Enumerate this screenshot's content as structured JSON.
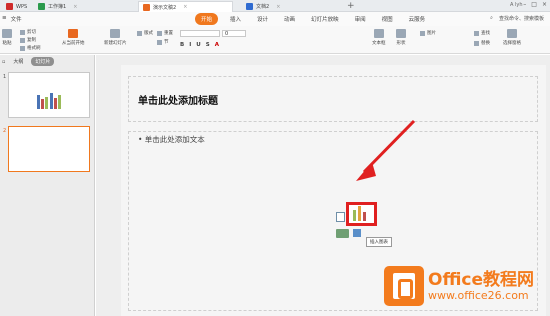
{
  "titlebar": {
    "tabs": [
      {
        "label": "WPS",
        "color": "#cf2b2b"
      },
      {
        "label": "工作簿1",
        "color": "#2a9a4c"
      },
      {
        "label": "演示文稿2",
        "color": "#e86820"
      },
      {
        "label": "文档2",
        "color": "#2f6bd1"
      }
    ],
    "account": "A lyh"
  },
  "menu": {
    "file": "文件",
    "tabs": [
      "开始",
      "插入",
      "设计",
      "动画",
      "幻灯片放映",
      "审阅",
      "视图",
      "云服务"
    ],
    "active_tab": "开始",
    "search": "查找命令、搜索模板"
  },
  "ribbon": {
    "paste": "粘贴",
    "cut": "剪切",
    "copy": "复制",
    "format": "格式刷",
    "play_from": "从当前开始",
    "new_slide": "新建幻灯片",
    "layout": "版式",
    "reset": "重置",
    "section": "节",
    "font_size": "0",
    "textbox": "文本框",
    "shape": "形状",
    "picture": "图片",
    "find": "查找",
    "replace": "替换",
    "select_pane": "选择窗格",
    "format_buttons": [
      "B",
      "I",
      "U",
      "S",
      "A"
    ]
  },
  "panel": {
    "tabs": [
      "大纲",
      "幻灯片"
    ],
    "active_tab": "幻灯片",
    "slide_numbers": [
      "1",
      "2"
    ]
  },
  "slide": {
    "title_placeholder": "单击此处添加标题",
    "body_placeholder": "• 单击此处添加文本",
    "tooltip": "插入图表"
  },
  "watermark": {
    "line1": "Office教程网",
    "line2": "www.office26.com"
  },
  "colors": {
    "accent": "#f0781e",
    "highlight": "#e02020"
  }
}
